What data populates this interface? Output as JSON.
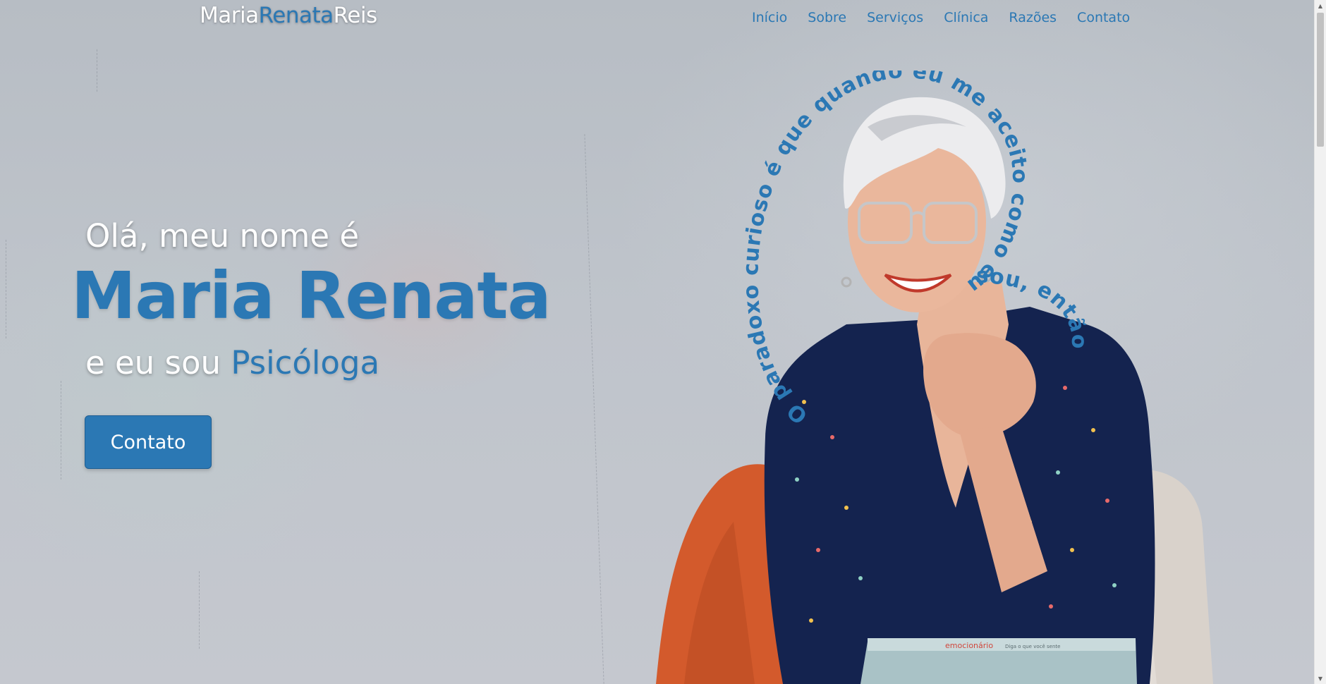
{
  "brand": {
    "part1": "Maria",
    "part2": "Renata",
    "part3": "Reis"
  },
  "nav": {
    "items": [
      {
        "label": "Início"
      },
      {
        "label": "Sobre"
      },
      {
        "label": "Serviços"
      },
      {
        "label": "Clínica"
      },
      {
        "label": "Razões"
      },
      {
        "label": "Contato"
      }
    ]
  },
  "hero": {
    "greeting": "Olá, meu nome é",
    "name": "Maria Renata",
    "role_prefix": "e eu sou",
    "role": "Psicóloga",
    "cta_label": "Contato",
    "quote": "O paradoxo curioso é que quando eu me aceito como eu sou, então eu mudo.",
    "book_title": "emocionário",
    "book_subtitle": "Diga o que você sente"
  },
  "colors": {
    "accent": "#2b78b4",
    "white": "#ffffff",
    "shirt": "#14234f",
    "blanket": "#d35a2c",
    "armchair": "#d7d0c9"
  },
  "icons": {
    "scroll_up": "chevron-up-icon",
    "scroll_down": "chevron-down-icon"
  }
}
